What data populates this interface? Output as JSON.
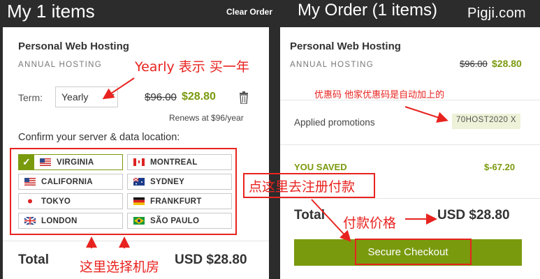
{
  "header": {
    "left_title": "My 1 items",
    "clear_order": "Clear Order",
    "right_title": "My Order (1 items)",
    "watermark": "Pigji.com"
  },
  "left_card": {
    "product_name": "Personal Web Hosting",
    "product_type": "ANNUAL HOSTING",
    "term_label": "Term:",
    "term_value": "Yearly",
    "old_price": "$96.00",
    "new_price": "$28.80",
    "renews": "Renews at $96/year",
    "confirm_location": "Confirm your server & data location:",
    "locations": [
      {
        "name": "VIRGINIA",
        "flag": "us-flag",
        "selected": true
      },
      {
        "name": "MONTREAL",
        "flag": "ca-flag",
        "selected": false
      },
      {
        "name": "CALIFORNIA",
        "flag": "us-flag",
        "selected": false
      },
      {
        "name": "SYDNEY",
        "flag": "au-flag",
        "selected": false
      },
      {
        "name": "TOKYO",
        "flag": "jp-flag",
        "selected": false
      },
      {
        "name": "FRANKFURT",
        "flag": "de-flag",
        "selected": false
      },
      {
        "name": "LONDON",
        "flag": "uk-flag",
        "selected": false
      },
      {
        "name": "SÃO PAULO",
        "flag": "br-flag",
        "selected": false
      }
    ],
    "total_label": "Total",
    "total_value": "USD $28.80"
  },
  "right_card": {
    "product_name": "Personal Web Hosting",
    "product_type": "ANNUAL HOSTING",
    "old_price": "$96.00",
    "new_price": "$28.80",
    "applied_label": "Applied promotions",
    "promo_code": "70HOST2020 X",
    "saved_label": "YOU SAVED",
    "saved_value": "$-67.20",
    "total_label": "Total",
    "total_value": "USD $28.80",
    "checkout_label": "Secure Checkout"
  },
  "annotations": {
    "yearly_note": "Yearly 表示 买一年",
    "promo_note": "优惠码 他家优惠码是自动加上的",
    "checkout_note": "点这里去注册付款",
    "price_note": "付款价格",
    "location_note": "这里选择机房"
  },
  "colors": {
    "accent_green": "#7a9a0e",
    "annotation_red": "#e8231f",
    "page_bg": "#2c2c2c"
  }
}
